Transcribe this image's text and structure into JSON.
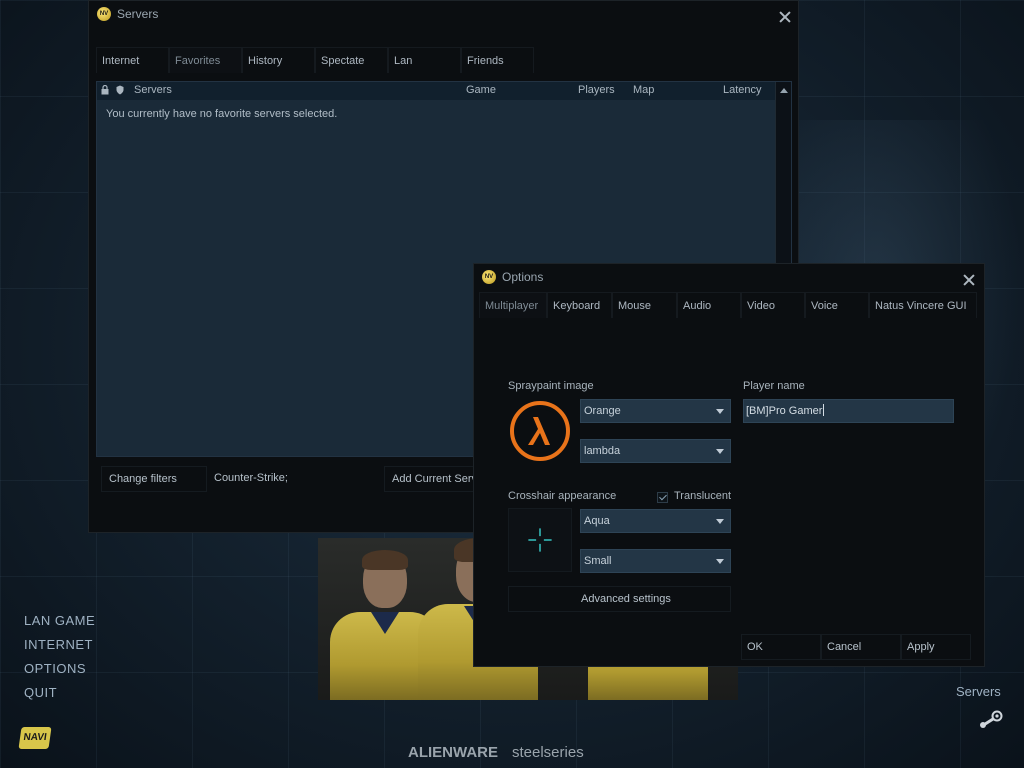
{
  "servers_window": {
    "title": "Servers",
    "tabs": [
      "Internet",
      "Favorites",
      "History",
      "Spectate",
      "Lan",
      "Friends"
    ],
    "active_tab": "Favorites",
    "columns": {
      "servers": "Servers",
      "game": "Game",
      "players": "Players",
      "map": "Map",
      "latency": "Latency"
    },
    "empty_message": "You currently have no favorite servers selected.",
    "footer": {
      "change_filters": "Change filters",
      "filter_value": "Counter-Strike;",
      "add_current": "Add Current Serv"
    }
  },
  "options_dialog": {
    "title": "Options",
    "tabs": [
      "Multiplayer",
      "Keyboard",
      "Mouse",
      "Audio",
      "Video",
      "Voice",
      "Natus Vincere GUI"
    ],
    "active_tab": "Multiplayer",
    "spraypaint": {
      "label": "Spraypaint image",
      "color": "Orange",
      "image": "lambda"
    },
    "player_name": {
      "label": "Player name",
      "value": "[BM]Pro Gamer"
    },
    "crosshair": {
      "label": "Crosshair appearance",
      "translucent_label": "Translucent",
      "translucent": true,
      "color": "Aqua",
      "size": "Small"
    },
    "advanced_settings": "Advanced settings",
    "buttons": {
      "ok": "OK",
      "cancel": "Cancel",
      "apply": "Apply"
    }
  },
  "main_menu": [
    "LAN GAME",
    "INTERNET",
    "OPTIONS",
    "QUIT"
  ],
  "logo_text": "NAVI",
  "sponsors": [
    "ALIENWARE",
    "steelseries"
  ],
  "servers_link": "Servers",
  "colors": {
    "spray_orange": "#e8731a",
    "crosshair_aqua": "#38c8c8",
    "navi_yellow": "#d8c64a"
  }
}
